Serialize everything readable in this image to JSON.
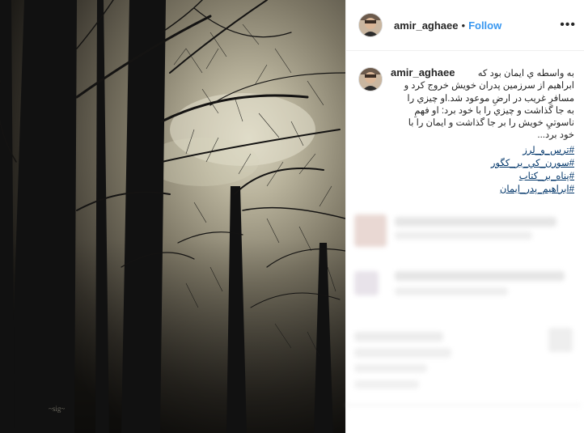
{
  "post": {
    "username": "amir_aghaee",
    "separator": "•",
    "follow_label": "Follow",
    "more_label": "•••"
  },
  "caption": {
    "username": "amir_aghaee",
    "line1": "به واسطه ي ايمان بود كه",
    "line2": "ابراهيم از سرزمين پدران خويش خروج كرد و",
    "line3": "مسافرِ غريب در ارضِ موعود شد.او چيزي را",
    "line4": "به جا گذاشت و چيزي را با خود برد: او فهمِ",
    "line5": "ناسوتيِ خويش را بر جا گذاشت و ايمان را با",
    "line6": "خود برد...",
    "hashtags": [
      "#ترس_و_لرز",
      "#سورن_كي_ير_كگور",
      "#پناه_بر_كتاب",
      "#ابراهيم_پدر_ايمان"
    ]
  }
}
